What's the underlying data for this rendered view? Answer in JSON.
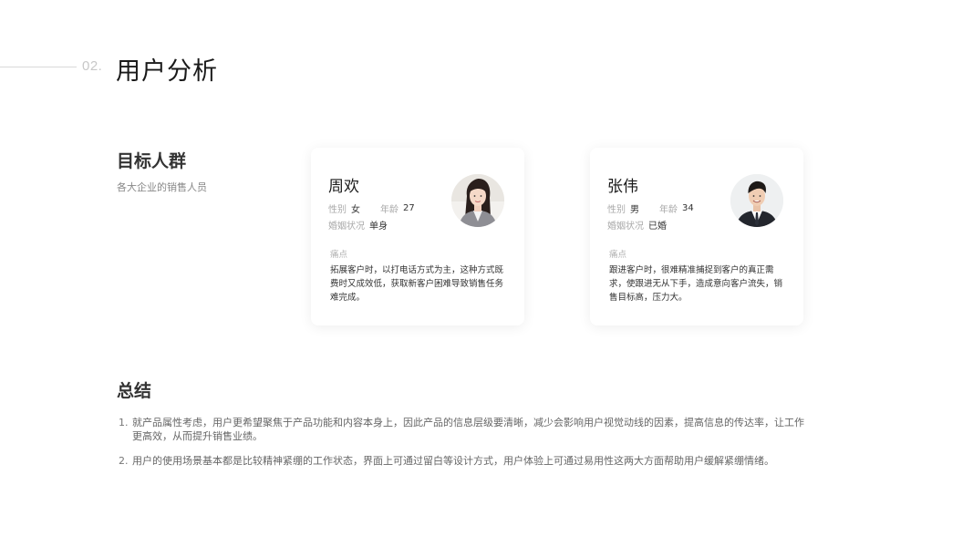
{
  "header": {
    "section_number": "02.",
    "title": "用户分析"
  },
  "target": {
    "title": "目标人群",
    "subtitle": "各大企业的销售人员"
  },
  "personas": [
    {
      "name": "周欢",
      "gender_label": "性别",
      "gender": "女",
      "age_label": "年龄",
      "age": "27",
      "marital_label": "婚姻状况",
      "marital": "单身",
      "pain_label": "痛点",
      "pain_text": "拓展客户时，以打电话方式为主，这种方式既费时又成效低，获取新客户困难导致销售任务难完成。",
      "avatar_icon": "female-avatar-photo"
    },
    {
      "name": "张伟",
      "gender_label": "性别",
      "gender": "男",
      "age_label": "年龄",
      "age": "34",
      "marital_label": "婚姻状况",
      "marital": "已婚",
      "pain_label": "痛点",
      "pain_text": "跟进客户时，很难精准捕捉到客户的真正需求，使跟进无从下手，造成意向客户流失，销售目标高，压力大。",
      "avatar_icon": "male-avatar-photo"
    }
  ],
  "summary": {
    "title": "总结",
    "items": [
      {
        "num": "1.",
        "text": "就产品属性考虑，用户更希望聚焦于产品功能和内容本身上，因此产品的信息层级要清晰，减少会影响用户视觉动线的因素，提高信息的传达率，让工作更高效，从而提升销售业绩。"
      },
      {
        "num": "2.",
        "text": "用户的使用场景基本都是比较精神紧绷的工作状态，界面上可通过留白等设计方式，用户体验上可通过易用性这两大方面帮助用户缓解紧绷情绪。"
      }
    ]
  },
  "colors": {
    "text_primary": "#1a1a1a",
    "text_muted": "#aaaaaa",
    "card_bg": "#ffffff"
  }
}
